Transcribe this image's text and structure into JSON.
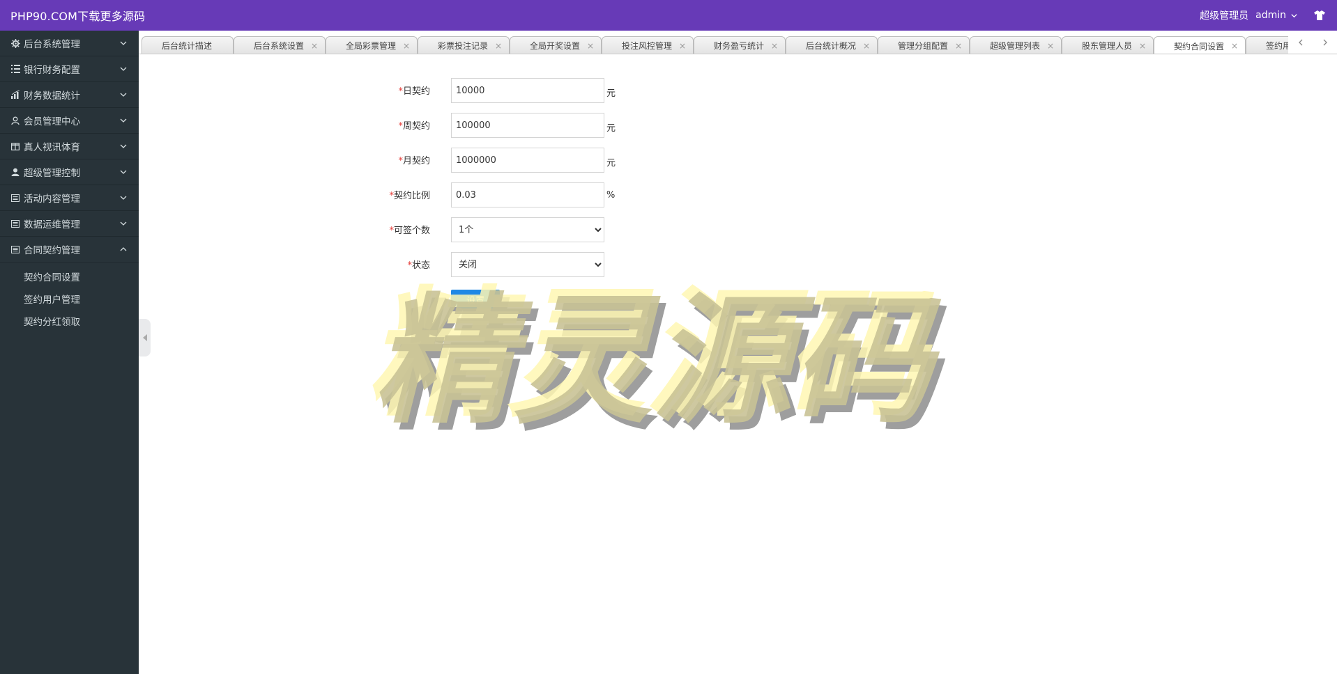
{
  "header": {
    "logo": "PHP90.COM下载更多源码",
    "role": "超级管理员",
    "username": "admin",
    "theme_icon": "tshirt-icon"
  },
  "sidebar": {
    "items": [
      {
        "label": "后台系统管理",
        "icon": "gear-icon"
      },
      {
        "label": "银行财务配置",
        "icon": "list-icon"
      },
      {
        "label": "财务数据统计",
        "icon": "chart-icon"
      },
      {
        "label": "会员管理中心",
        "icon": "user-icon"
      },
      {
        "label": "真人视讯体育",
        "icon": "gift-icon"
      },
      {
        "label": "超级管理控制",
        "icon": "user-solid-icon"
      },
      {
        "label": "活动内容管理",
        "icon": "document-icon"
      },
      {
        "label": "数据运维管理",
        "icon": "document-icon"
      },
      {
        "label": "合同契约管理",
        "icon": "document-icon"
      }
    ],
    "submenu": [
      "契约合同设置",
      "签约用户管理",
      "契约分红领取"
    ]
  },
  "tabs": [
    {
      "label": "后台统计描述"
    },
    {
      "label": "后台系统设置"
    },
    {
      "label": "全局彩票管理"
    },
    {
      "label": "彩票投注记录"
    },
    {
      "label": "全局开奖设置"
    },
    {
      "label": "投注风控管理"
    },
    {
      "label": "财务盈亏统计"
    },
    {
      "label": "后台统计概况"
    },
    {
      "label": "管理分组配置"
    },
    {
      "label": "超级管理列表"
    },
    {
      "label": "股东管理人员"
    },
    {
      "label": "契约合同设置"
    },
    {
      "label": "签约用"
    }
  ],
  "active_tab": "契约合同设置",
  "form": {
    "daily": {
      "label": "日契约",
      "value": "10000",
      "unit": "元"
    },
    "weekly": {
      "label": "周契约",
      "value": "100000",
      "unit": "元"
    },
    "monthly": {
      "label": "月契约",
      "value": "1000000",
      "unit": "元"
    },
    "ratio": {
      "label": "契约比例",
      "value": "0.03",
      "unit": "%"
    },
    "count": {
      "label": "可签个数",
      "selected": "1个"
    },
    "status": {
      "label": "状态",
      "selected": "关闭"
    },
    "submit_label": "设置"
  },
  "required_mark": "*",
  "watermark": "精灵源码",
  "colors": {
    "header_bg": "#673ab7",
    "sidebar_bg": "#283339",
    "required": "#e53935",
    "button": "#1e88e5"
  }
}
